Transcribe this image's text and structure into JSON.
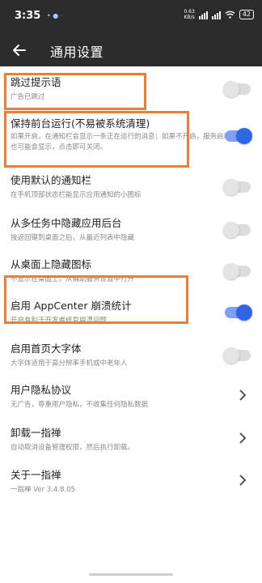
{
  "status": {
    "time": "3:35",
    "network_rate": "0.63",
    "network_unit": "KB/s",
    "battery": "42"
  },
  "header": {
    "title": "通用设置"
  },
  "colors": {
    "accent": "#2f66e8",
    "highlight": "#f07c36",
    "bar": "#2c2c2c"
  },
  "settings": [
    {
      "title": "跳过提示语",
      "subtitle": "广告已跳过",
      "control": "toggle",
      "on": false
    },
    {
      "title": "保持前台运行(不易被系统清理)",
      "subtitle": "如果开启，在通知栏会显示一条正在运行的消息；如果不开启，服务启动时也可能会显示，点击即可关闭。",
      "control": "toggle",
      "on": true
    },
    {
      "title": "使用默认的通知栏",
      "subtitle": "在手机顶部状态栏能显示应用通知的小图标",
      "control": "toggle",
      "on": false
    },
    {
      "title": "从多任务中隐藏应用后台",
      "subtitle": "按返回键到桌面之后，从最近列表中隐藏",
      "control": "toggle",
      "on": false
    },
    {
      "title": "从桌面上隐藏图标",
      "subtitle": "不显示在桌面上，从辅助服务设置中打开",
      "control": "toggle",
      "on": false
    },
    {
      "title": "启用 AppCenter 崩溃统计",
      "subtitle": "开启有利于开发者修复崩溃问题",
      "control": "toggle",
      "on": true
    },
    {
      "title": "启用首页大字体",
      "subtitle": "大字体适用于高分辨率手机或中老年人",
      "control": "toggle",
      "on": false
    },
    {
      "title": "用户隐私协议",
      "subtitle": "无广告，尊重用户隐私，不收集任何隐私数据",
      "control": "chevron"
    },
    {
      "title": "卸载一指禅",
      "subtitle": "自动取消设备管理权限，然后执行卸载。",
      "control": "chevron"
    },
    {
      "title": "关于一指禅",
      "subtitle": "一指禅 Ver 3.4.8.05",
      "control": "chevron"
    }
  ]
}
